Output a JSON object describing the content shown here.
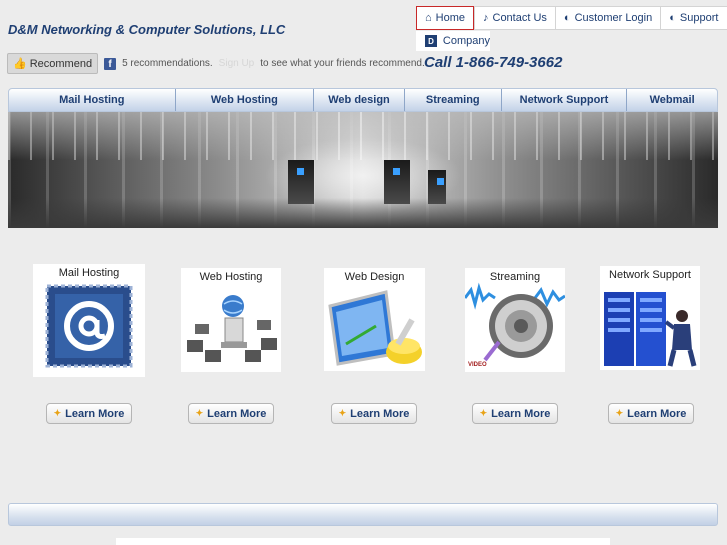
{
  "brand": "D&M Networking & Computer Solutions, LLC",
  "topnav": [
    {
      "label": "Home",
      "icon": "house-icon",
      "glyph": "⌂"
    },
    {
      "label": "Contact Us",
      "icon": "music-note-icon",
      "glyph": "♪"
    },
    {
      "label": "Customer Login",
      "icon": "cycle-icon",
      "glyph": "◐"
    },
    {
      "label": "Support",
      "icon": "cycle-icon",
      "glyph": "◐"
    }
  ],
  "company": {
    "badge": "D",
    "label": "Company"
  },
  "facebook": {
    "button_label": "Recommend",
    "count_text": "5 recommendations.",
    "signup_link": "Sign Up",
    "suffix": "to see what your friends recommend."
  },
  "phone": "Call 1-866-749-3662",
  "mainnav": [
    "Mail Hosting",
    "Web Hosting",
    "Web design",
    "Streaming",
    "Network Support",
    "Webmail"
  ],
  "services": [
    {
      "caption": "Mail Hosting",
      "button": "Learn More"
    },
    {
      "caption": "Web Hosting",
      "button": "Learn More"
    },
    {
      "caption": "Web Design",
      "button": "Learn More"
    },
    {
      "caption": "Streaming",
      "button": "Learn More",
      "tag": "VIDEO"
    },
    {
      "caption": "Network Support",
      "button": "Learn More"
    }
  ],
  "colors": {
    "brand": "#1f3f73",
    "accent": "#e8a317",
    "active_border": "#c82828"
  }
}
